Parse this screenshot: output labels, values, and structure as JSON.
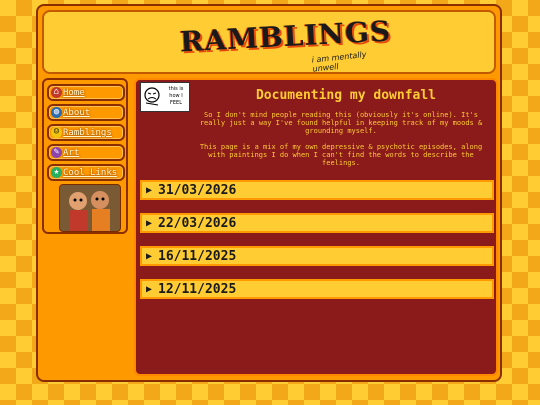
{
  "header": {
    "logo_text": "RAMBLINGS",
    "logo_subtext": "i am mentally unwell"
  },
  "sidebar": {
    "items": [
      {
        "label": "Home",
        "icon": "home-icon"
      },
      {
        "label": "About",
        "icon": "globe-icon"
      },
      {
        "label": "Ramblings",
        "icon": "smiley-icon"
      },
      {
        "label": "Art",
        "icon": "palette-icon"
      },
      {
        "label": "Cool Links",
        "icon": "star-icon"
      }
    ]
  },
  "main": {
    "badge_text": [
      "this is",
      "how I",
      "FEEL"
    ],
    "title": "Documenting my downfall",
    "intro_1": "So I don't mind people reading this (obviously it's online). It's really just a way I've found helpful in keeping track of my moods & grounding myself.",
    "intro_2": "This page is a mix of my own depressive & psychotic episodes, along with paintings I do when I can't find the words to describe the feelings.",
    "entries": [
      {
        "date": "31/03/2026"
      },
      {
        "date": "22/03/2026"
      },
      {
        "date": "16/11/2025"
      },
      {
        "date": "12/11/2025"
      }
    ]
  },
  "colors": {
    "background": "#ffcc33",
    "frame": "#ff9900",
    "main_panel": "#8b1a1a",
    "accent_text": "#ffcc33"
  }
}
